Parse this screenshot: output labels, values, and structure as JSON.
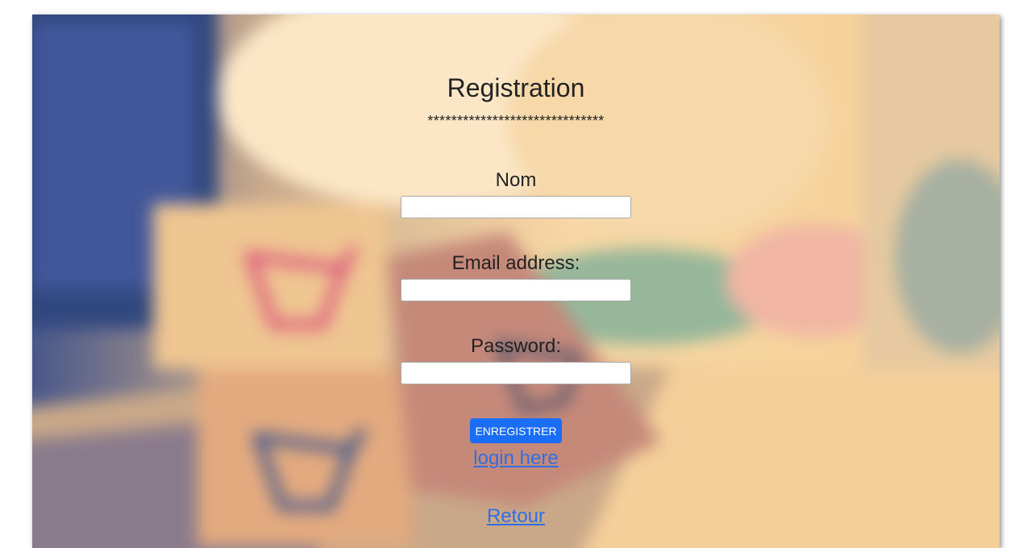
{
  "form": {
    "title": "Registration",
    "separator": "******************************",
    "name_label": "Nom",
    "name_value": "",
    "email_label": "Email address:",
    "email_value": "",
    "password_label": "Password:",
    "password_value": "",
    "submit_label": "ENREGISTRER",
    "login_link": "login here",
    "back_link": "Retour"
  },
  "background": {
    "description_icons": [
      "shopping-cart-icon",
      "shopping-cart-icon",
      "shopping-cart-icon"
    ]
  },
  "colors": {
    "button": "#1a6ef5",
    "link": "#2f6fe3",
    "text": "#222222"
  }
}
